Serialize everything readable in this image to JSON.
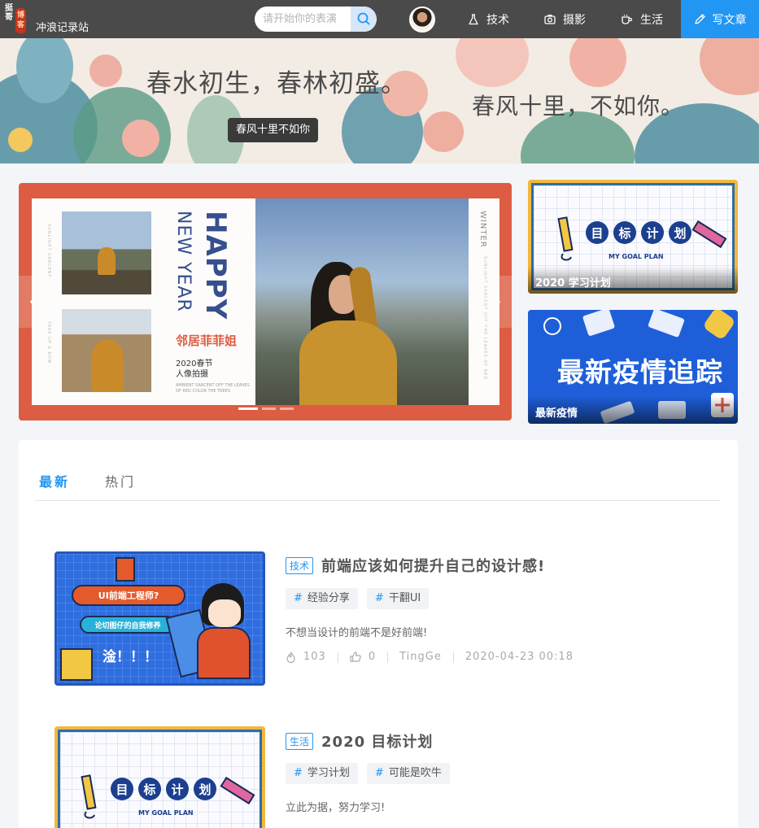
{
  "nav": {
    "logo_chars": "挺哥",
    "logo_seal": "博客",
    "site_name": "冲浪记录站",
    "search_placeholder": "请开始你的表演",
    "items": [
      {
        "label": "技术",
        "icon": "flask-icon"
      },
      {
        "label": "摄影",
        "icon": "camera-icon"
      },
      {
        "label": "生活",
        "icon": "coffee-icon"
      }
    ],
    "write_label": "写文章",
    "write_icon": "pen-icon",
    "accent": "#2196f3"
  },
  "hero": {
    "line1": "春水初生，春林初盛。",
    "line2": "春风十里，不如你。",
    "tag": "春风十里不如你"
  },
  "carousel": {
    "slide": {
      "happy": "HAPPY",
      "new_year": "NEW YEAR",
      "name": "邻居菲菲姐",
      "subtitle_1": "2020春节",
      "subtitle_2": "人像拍摄",
      "fineprint": "AMBIENT SARCENT OFF THE LEAVES OF RED COLOR THE TREES",
      "side_label": "WINTER",
      "side_fine": "SUNLIGHT SARCENT OFF THE LEAVES OF RED",
      "left_fine_1": "SUNLIGHT SARCENT",
      "left_fine_2": "TAKE UP A BOW"
    },
    "slide_count": 3,
    "active_index": 0
  },
  "side_cards": [
    {
      "caption": "2020 学习计划",
      "goal_chars": [
        "目",
        "标",
        "计",
        "划"
      ],
      "goal_sub": "MY GOAL PLAN"
    },
    {
      "caption": "最新疫情",
      "headline": "最新疫情追踪"
    }
  ],
  "feed": {
    "tabs": [
      {
        "label": "最新",
        "active": true
      },
      {
        "label": "热门",
        "active": false
      }
    ],
    "posts": [
      {
        "category": "技术",
        "title": "前端应该如何提升自己的设计感!",
        "tags": [
          "经验分享",
          "干翻UI"
        ],
        "description": "不想当设计的前端不是好前端!",
        "views": "103",
        "likes": "0",
        "author": "TingGe",
        "date": "2020-04-23 00:18",
        "thumb": {
          "pill1": "UI前端工程师?",
          "pill2": "论切图仔的自我修养",
          "exclaim": "淦！！！"
        }
      },
      {
        "category": "生活",
        "title": "2020 目标计划",
        "tags": [
          "学习计划",
          "可能是吹牛"
        ],
        "description": "立此为据，努力学习!",
        "thumb": {
          "goal_chars": [
            "目",
            "标",
            "计",
            "划"
          ],
          "goal_sub": "MY GOAL PLAN"
        }
      }
    ]
  }
}
